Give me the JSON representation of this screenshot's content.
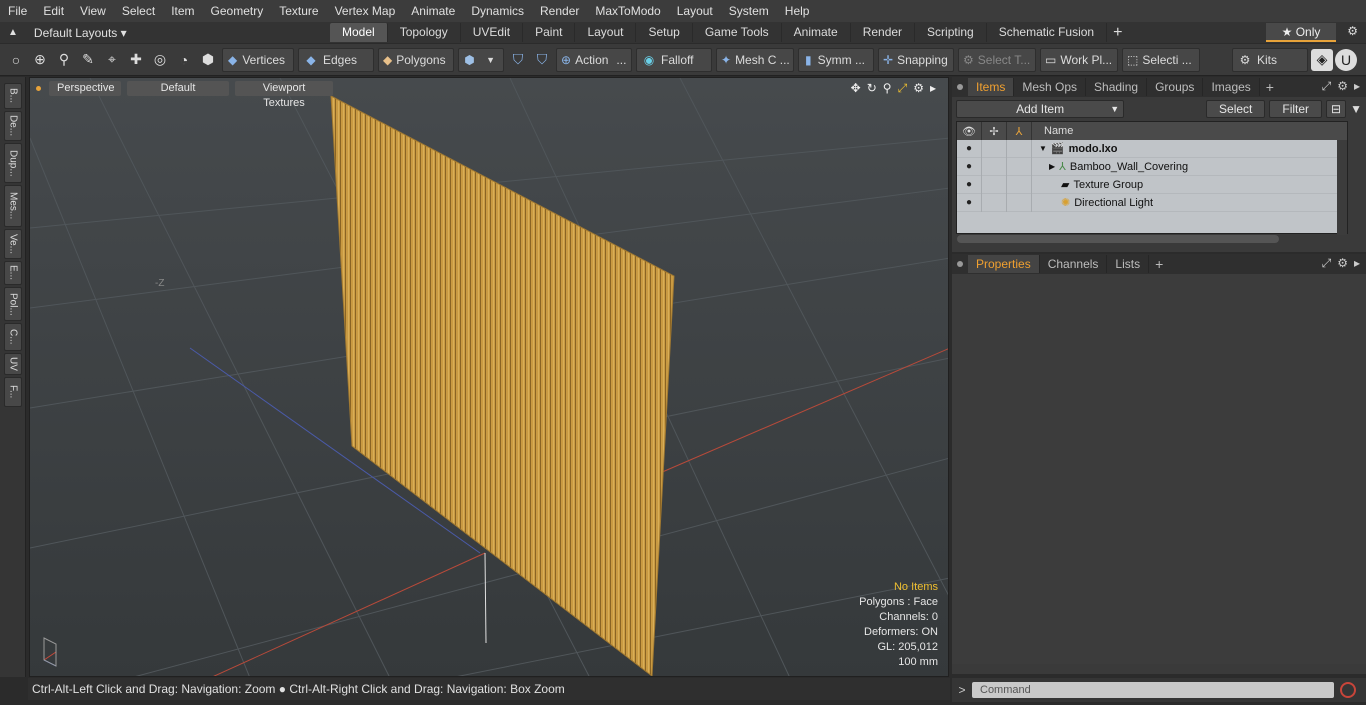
{
  "menu": [
    "File",
    "Edit",
    "View",
    "Select",
    "Item",
    "Geometry",
    "Texture",
    "Vertex Map",
    "Animate",
    "Dynamics",
    "Render",
    "MaxToModo",
    "Layout",
    "System",
    "Help"
  ],
  "layouts": {
    "label": "Default Layouts ▾"
  },
  "tabs": [
    "Model",
    "Topology",
    "UVEdit",
    "Paint",
    "Layout",
    "Setup",
    "Game Tools",
    "Animate",
    "Render",
    "Scripting",
    "Schematic Fusion"
  ],
  "only_label": "★ Only",
  "toolbar": {
    "vertices": "Vertices",
    "edges": "Edges",
    "polygons": "Polygons",
    "action": "Action",
    "falloff": "Falloff",
    "mesh": "Mesh C ...",
    "symm": "Symm ...",
    "snapping": "Snapping",
    "select_t": "Select T...",
    "work_pl": "Work Pl...",
    "selecti": "Selecti ...",
    "kits": "Kits"
  },
  "left_strip": [
    "B...",
    "De...",
    "Dup...",
    "Mes...",
    "Ve...",
    "E...",
    "Pol...",
    "C...",
    "UV",
    "F..."
  ],
  "viewport": {
    "perspective": "Perspective",
    "default": "Default",
    "textures": "Viewport Textures",
    "axis_label": "-Z",
    "info": {
      "no_items": "No Items",
      "polygons": "Polygons : Face",
      "channels": "Channels: 0",
      "deformers": "Deformers: ON",
      "gl": "GL: 205,012",
      "scale": "100 mm"
    }
  },
  "status": "Ctrl-Alt-Left Click and Drag: Navigation: Zoom ● Ctrl-Alt-Right Click and Drag: Navigation: Box Zoom",
  "items_panel": {
    "tabs": [
      "Items",
      "Mesh Ops",
      "Shading",
      "Groups",
      "Images"
    ],
    "add_item": "Add Item",
    "select": "Select",
    "filter": "Filter",
    "name_header": "Name",
    "rows": [
      {
        "name": "modo.lxo"
      },
      {
        "name": "Bamboo_Wall_Covering"
      },
      {
        "name": "Texture Group"
      },
      {
        "name": "Directional Light"
      }
    ]
  },
  "props_panel": {
    "tabs": [
      "Properties",
      "Channels",
      "Lists"
    ]
  },
  "command": {
    "prompt": ">",
    "placeholder": "Command"
  }
}
